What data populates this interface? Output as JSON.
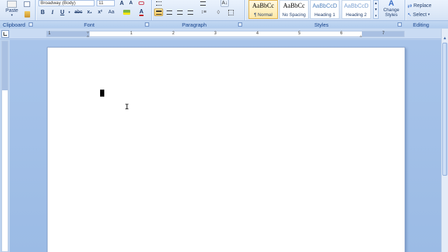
{
  "ribbon": {
    "clipboard": {
      "label": "Clipboard",
      "paste": "Paste"
    },
    "font": {
      "label": "Font",
      "font_name": "Broadway (Body)",
      "font_size": "11",
      "bold": "B",
      "italic": "I",
      "underline": "U",
      "strike": "abc",
      "subscript": "x₂",
      "superscript": "x²",
      "change_case": "Aa",
      "grow": "A",
      "shrink": "A",
      "font_color": "A"
    },
    "paragraph": {
      "label": "Paragraph"
    },
    "styles": {
      "label": "Styles",
      "items": [
        {
          "sample": "AaBbCc",
          "name": "¶ Normal",
          "selected": true
        },
        {
          "sample": "AaBbCc",
          "name": "No Spacing",
          "selected": false
        },
        {
          "sample": "AaBbCcD",
          "name": "Heading 1",
          "selected": false
        },
        {
          "sample": "AaBbCcD",
          "name": "Heading 2",
          "selected": false
        }
      ],
      "change_styles": "Change Styles"
    },
    "editing": {
      "label": "Editing",
      "replace": "Replace",
      "select": "Select"
    }
  },
  "ruler": {
    "numbers": [
      "1",
      "1",
      "2",
      "3",
      "4",
      "5",
      "6",
      "7"
    ]
  },
  "colors": {
    "ribbon_bg": "#dbe7f7",
    "active": "#f9c85b",
    "text": "#15428b",
    "workspace": "#a8c4ea"
  }
}
